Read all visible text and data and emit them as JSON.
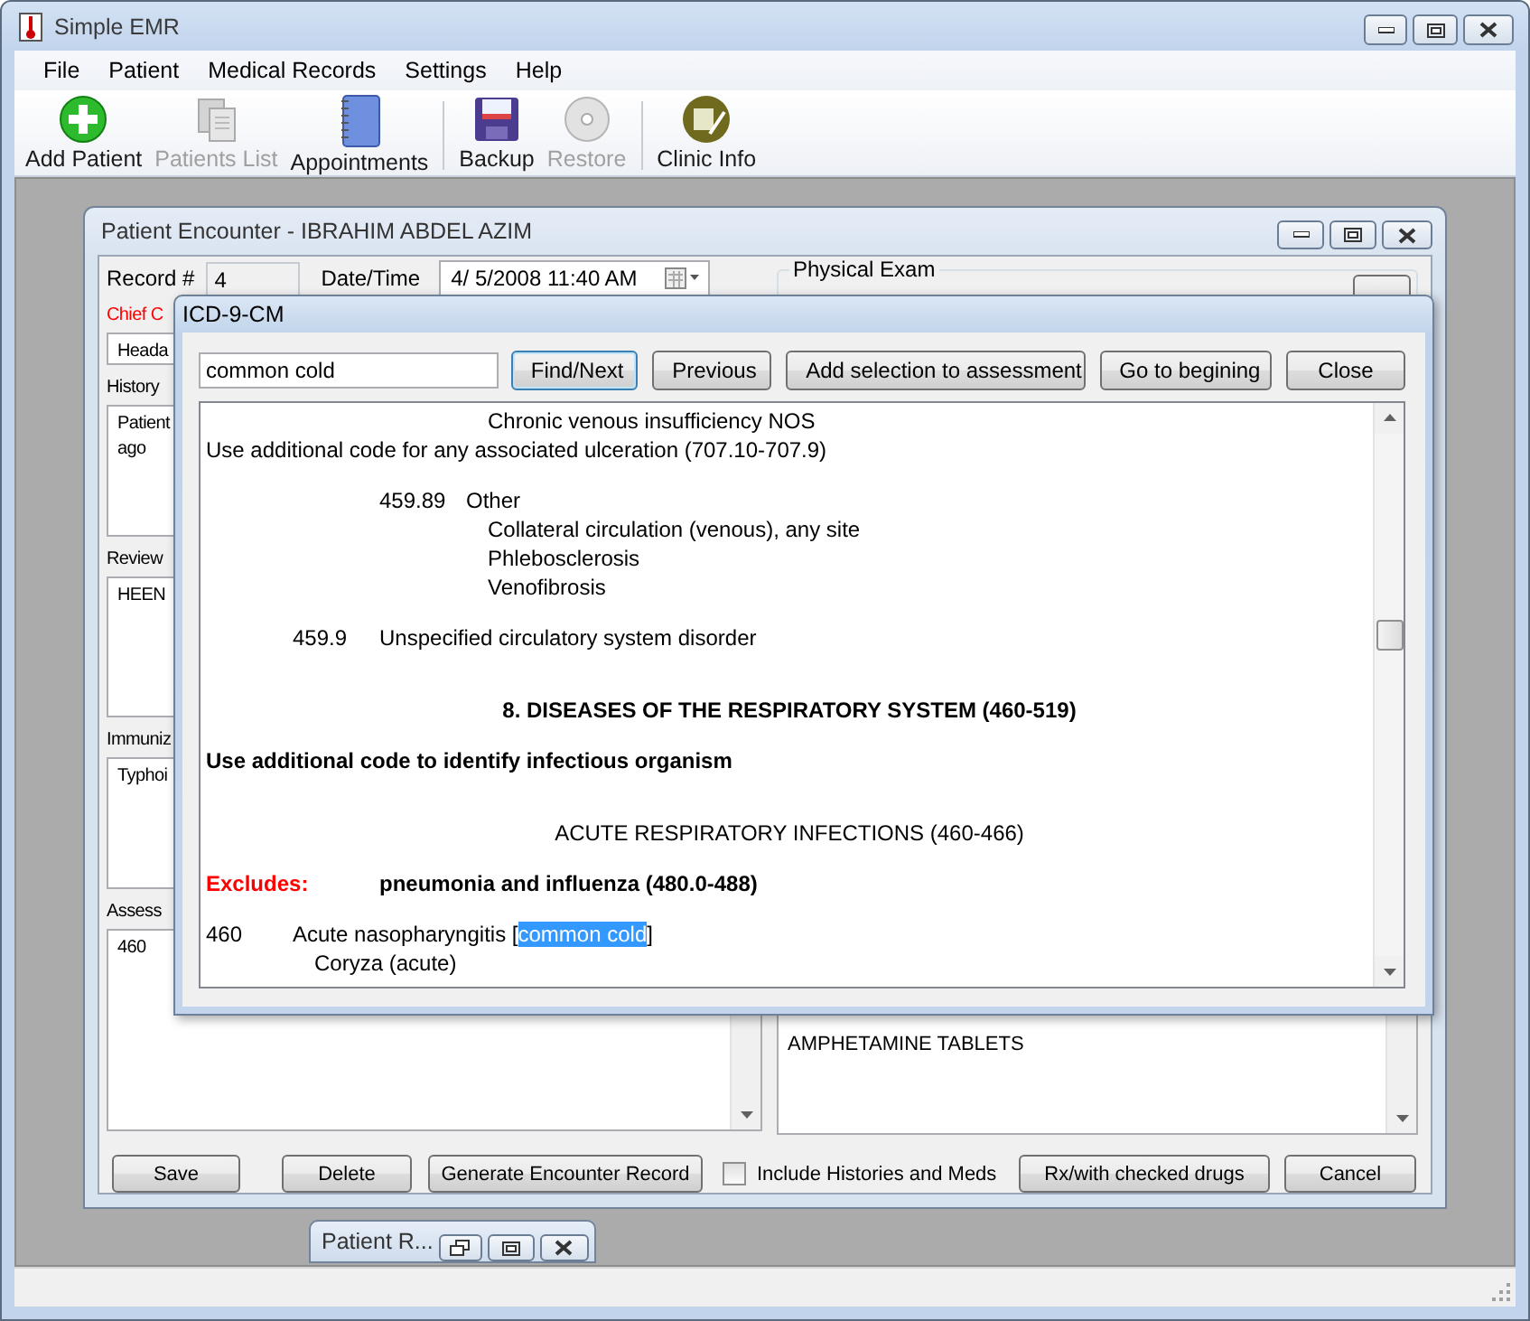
{
  "app": {
    "title": "Simple EMR"
  },
  "menu": [
    "File",
    "Patient",
    "Medical Records",
    "Settings",
    "Help"
  ],
  "toolbar": [
    {
      "kind": "button",
      "label": "Add Patient",
      "disabled": false
    },
    {
      "kind": "button",
      "label": "Patients List",
      "disabled": true
    },
    {
      "kind": "button",
      "label": "Appointments",
      "disabled": false
    },
    {
      "kind": "separator"
    },
    {
      "kind": "button",
      "label": "Backup",
      "disabled": false
    },
    {
      "kind": "button",
      "label": "Restore",
      "disabled": true
    },
    {
      "kind": "separator"
    },
    {
      "kind": "button",
      "label": "Clinic Info",
      "disabled": false
    }
  ],
  "encounter": {
    "title": "Patient Encounter - IBRAHIM ABDEL AZIM",
    "record_label": "Record #",
    "record": "4",
    "date_label": "Date/Time",
    "date": "4/  5/2008 11:40 AM",
    "fields": [
      {
        "label": "Chief C",
        "required": true,
        "kind": "line",
        "lines": [
          "Heada"
        ]
      },
      {
        "label": "History",
        "required": false,
        "kind": "area",
        "lines": [
          "Patient",
          "ago"
        ]
      },
      {
        "label": "Review",
        "required": false,
        "kind": "area",
        "lines": [
          "HEEN"
        ]
      },
      {
        "label": "Immuniz",
        "required": false,
        "kind": "area",
        "lines": [
          "Typhoi"
        ]
      },
      {
        "label": "Assess",
        "required": false,
        "kind": "list",
        "lines": [
          "460"
        ]
      }
    ],
    "exam": {
      "title": "Physical Exam"
    },
    "notes": [
      "AMPHETAMINE TABLETS"
    ],
    "actions": [
      {
        "kind": "button",
        "label": "Save"
      },
      {
        "kind": "button",
        "label": "Delete"
      },
      {
        "kind": "button",
        "label": "Generate Encounter Record"
      },
      {
        "kind": "checkbox",
        "label": "Include Histories and Meds",
        "checked": false
      },
      {
        "kind": "button",
        "label": "Rx/with checked drugs"
      },
      {
        "kind": "button",
        "label": "Cancel"
      }
    ]
  },
  "icd": {
    "title": "ICD-9-CM",
    "search": "common cold",
    "buttons": [
      {
        "label": "Find/Next",
        "default": true
      },
      {
        "label": "Previous",
        "default": false
      },
      {
        "label": "Add selection to assessment",
        "default": false
      },
      {
        "label": "Go to begining",
        "default": false
      },
      {
        "label": "Close",
        "default": false
      }
    ],
    "lines": [
      {
        "kind": "note",
        "text": "Chronic venous insufficiency NOS"
      },
      {
        "kind": "plain",
        "text": "Use additional code for any associated ulceration (707.10-707.9)"
      },
      {
        "kind": "subcode",
        "code": "459.89",
        "text": "Other"
      },
      {
        "kind": "note",
        "text": "Collateral circulation (venous), any site"
      },
      {
        "kind": "note",
        "text": "Phlebosclerosis"
      },
      {
        "kind": "note",
        "text": "Venofibrosis"
      },
      {
        "kind": "code",
        "code": "459.9",
        "text": "Unspecified circulatory system disorder"
      },
      {
        "kind": "chapter",
        "text": "8.  DISEASES OF THE RESPIRATORY SYSTEM (460-519)"
      },
      {
        "kind": "bold",
        "text": "Use additional code to identify infectious organism"
      },
      {
        "kind": "section",
        "text": "ACUTE RESPIRATORY INFECTIONS (460-466)"
      },
      {
        "kind": "excludes",
        "label": "Excludes:",
        "text": "pneumonia and influenza (480.0-488)"
      },
      {
        "kind": "entry",
        "code": "460",
        "text": "Acute nasopharyngitis [",
        "highlight": "common cold",
        "after": "]"
      },
      {
        "kind": "desc",
        "text": "Coryza (acute)"
      }
    ]
  },
  "minimized": {
    "title": "Patient R..."
  }
}
